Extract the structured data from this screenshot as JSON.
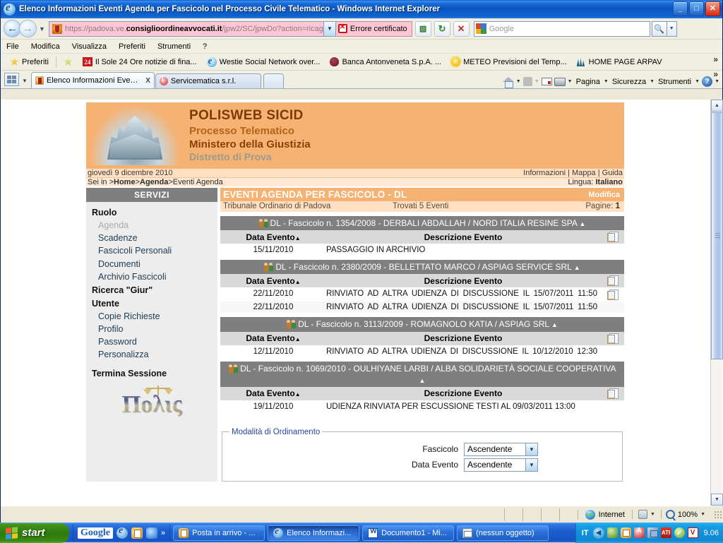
{
  "window": {
    "title": "Elenco Informazioni Eventi Agenda per Fascicolo nel Processo Civile Telematico - Windows Internet Explorer",
    "minimize": "_",
    "maximize": "□",
    "close": "✕"
  },
  "address": {
    "url_dim_prefix": "https://padova.ve.",
    "url_strong": "consiglioordineavvocati.it",
    "url_dim_suffix": "/jpw2/SC/jpwDo?action=ricagevId",
    "cert_error": "Errore certificato",
    "dropdown_caret": "▼"
  },
  "search": {
    "placeholder": "Google",
    "go_icon": "search-icon",
    "caret": "▼"
  },
  "menu": {
    "items": [
      "File",
      "Modifica",
      "Visualizza",
      "Preferiti",
      "Strumenti",
      "?"
    ]
  },
  "favorites": {
    "label": "Preferiti",
    "items": [
      {
        "label": "Il Sole 24 Ore notizie di fina...",
        "icon": "sole24-icon"
      },
      {
        "label": "Westie Social Network over...",
        "icon": "ie-icon"
      },
      {
        "label": "Banca Antonveneta S.p.A. ...",
        "icon": "banca-icon"
      },
      {
        "label": "METEO  Previsioni del Temp...",
        "icon": "meteo-icon"
      },
      {
        "label": "HOME PAGE ARPAV",
        "icon": "arpav-icon"
      }
    ],
    "overflow": "»"
  },
  "tabs": [
    {
      "label": "Elenco Informazioni Even...",
      "active": true,
      "close": "X"
    },
    {
      "label": "Servicematica s.r.l.",
      "active": false,
      "close": ""
    }
  ],
  "commandbar": {
    "items": [
      "Pagina",
      "Sicurezza",
      "Strumenti"
    ],
    "caret": "▼",
    "overflow": "»"
  },
  "banner": {
    "title": "POLISWEB SICID",
    "line2": "Processo Telematico",
    "line3": "Ministero della Giustizia",
    "line4": "Distretto di Prova"
  },
  "infobar": {
    "date": "giovedì 9 dicembre 2010",
    "links": "Informazioni | Mappa | Guida",
    "breadcrumb_prefix": "Sei in >",
    "breadcrumb_home": "Home",
    "breadcrumb_sep1": ">",
    "breadcrumb_agenda": "Agenda",
    "breadcrumb_sep2": ">",
    "breadcrumb_current": "Eventi Agenda",
    "lang_label": "Lingua: ",
    "lang_value": "Italiano"
  },
  "sidebar": {
    "header": "SERVIZI",
    "groups": [
      {
        "label": "Ruolo",
        "items": [
          {
            "label": "Agenda",
            "disabled": true
          },
          {
            "label": "Scadenze",
            "disabled": false
          },
          {
            "label": "Fascicoli Personali",
            "disabled": false
          },
          {
            "label": "Documenti",
            "disabled": false
          },
          {
            "label": "Archivio Fascicoli",
            "disabled": false
          }
        ]
      },
      {
        "label": "Ricerca \"Giur\"",
        "items": []
      },
      {
        "label": "Utente",
        "items": [
          {
            "label": "Copie Richieste",
            "disabled": false
          },
          {
            "label": "Profilo",
            "disabled": false
          },
          {
            "label": "Password",
            "disabled": false
          },
          {
            "label": "Personalizza",
            "disabled": false
          }
        ]
      },
      {
        "label": "Termina Sessione",
        "items": []
      }
    ],
    "logo_text": "Πολις"
  },
  "main": {
    "title": "EVENTI AGENDA PER FASCICOLO - DL",
    "modifica": "Modifica",
    "tribunale": "Tribunale Ordinario di Padova",
    "trovati": "Trovati 5 Eventi",
    "pagine_label": "Pagine: ",
    "pagine_value": "1",
    "column_date": "Data Evento",
    "column_desc": "Descrizione Evento",
    "sort_tri": "▲",
    "collapse_tri": "▲",
    "fascicoli": [
      {
        "header": "DL - Fascicolo n. 1354/2008 - DERBALI ABDALLAH / NORD ITALIA RESINE SPA",
        "events": [
          {
            "date": "15/11/2010",
            "desc": "PASSAGGIO IN ARCHIVIO",
            "justify": false,
            "doc": false
          }
        ]
      },
      {
        "header": "DL - Fascicolo n. 2380/2009 - BELLETTATO MARCO / ASPIAG SERVICE SRL",
        "events": [
          {
            "date": "22/11/2010",
            "desc": "RINVIATO AD ALTRA UDIENZA DI DISCUSSIONE IL 15/07/2011 11:50",
            "justify": true,
            "doc": true
          },
          {
            "date": "22/11/2010",
            "desc": "RINVIATO AD ALTRA UDIENZA DI DISCUSSIONE IL 15/07/2011 11:50",
            "justify": true,
            "doc": false
          }
        ]
      },
      {
        "header": "DL - Fascicolo n. 3113/2009 - ROMAGNOLO KATIA / ASPIAG SRL",
        "events": [
          {
            "date": "12/11/2010",
            "desc": "RINVIATO AD ALTRA UDIENZA DI DISCUSSIONE IL 10/12/2010 12:30",
            "justify": true,
            "doc": false
          }
        ]
      },
      {
        "header": "DL - Fascicolo n. 1069/2010 - OULHIYANE LARBI / ALBA SOLIDARIETÀ SOCIALE COOPERATIVA",
        "events": [
          {
            "date": "19/11/2010",
            "desc": "UDIENZA RINVIATA PER ESCUSSIONE TESTI AL 09/03/2011 13:00",
            "justify": false,
            "doc": false
          }
        ]
      }
    ]
  },
  "sort": {
    "legend": "Modalità di Ordinamento",
    "rows": [
      {
        "label": "Fascicolo",
        "value": "Ascendente"
      },
      {
        "label": "Data Evento",
        "value": "Ascendente"
      }
    ],
    "caret": "▼"
  },
  "statusbar": {
    "zone": "Internet",
    "zoom": "100%",
    "zoom_caret": "▼"
  },
  "taskbar": {
    "start": "start",
    "quicklaunch_google": "Google",
    "quicklaunch_overflow": "»",
    "buttons": [
      {
        "label": "Posta in arrivo - ...",
        "icon": "outlook-icon",
        "active": false
      },
      {
        "label": "Elenco Informazi...",
        "icon": "ie-icon",
        "active": true
      },
      {
        "label": "Documento1 - Mi...",
        "icon": "word-icon",
        "active": false
      },
      {
        "label": "(nessun oggetto)",
        "icon": "mail-icon",
        "active": false
      }
    ],
    "lang": "IT",
    "clock": "9.06"
  }
}
